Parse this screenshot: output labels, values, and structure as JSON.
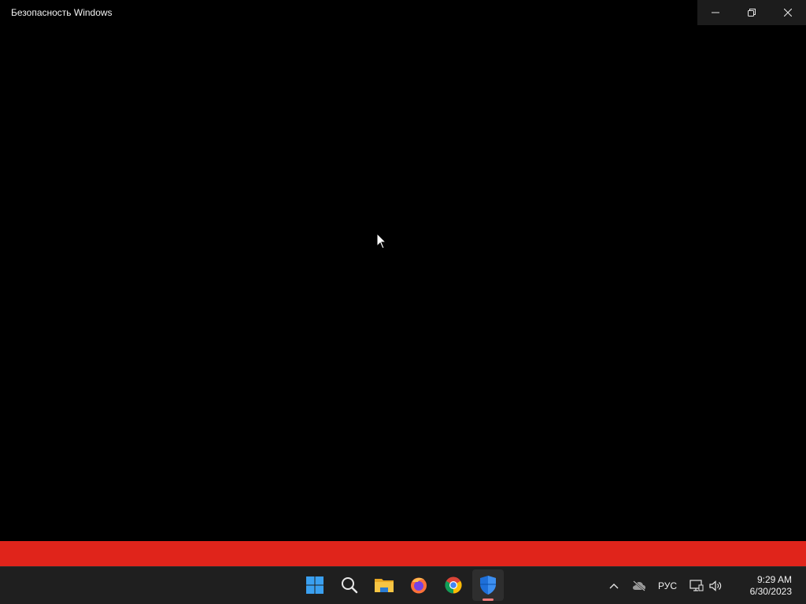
{
  "window": {
    "title": "Безопасность Windows",
    "caption_buttons": [
      "minimize",
      "restore",
      "close"
    ]
  },
  "banner": {
    "color": "#e0241b"
  },
  "taskbar": {
    "apps": [
      {
        "name": "start",
        "icon": "windows-logo-icon"
      },
      {
        "name": "search",
        "icon": "search-icon"
      },
      {
        "name": "file-explorer",
        "icon": "folder-icon"
      },
      {
        "name": "firefox",
        "icon": "firefox-icon"
      },
      {
        "name": "chrome",
        "icon": "chrome-icon"
      },
      {
        "name": "windows-security",
        "icon": "shield-icon",
        "active": true
      }
    ],
    "tray": {
      "language": "РУС",
      "time": "9:29 AM",
      "date": "6/30/2023"
    }
  }
}
